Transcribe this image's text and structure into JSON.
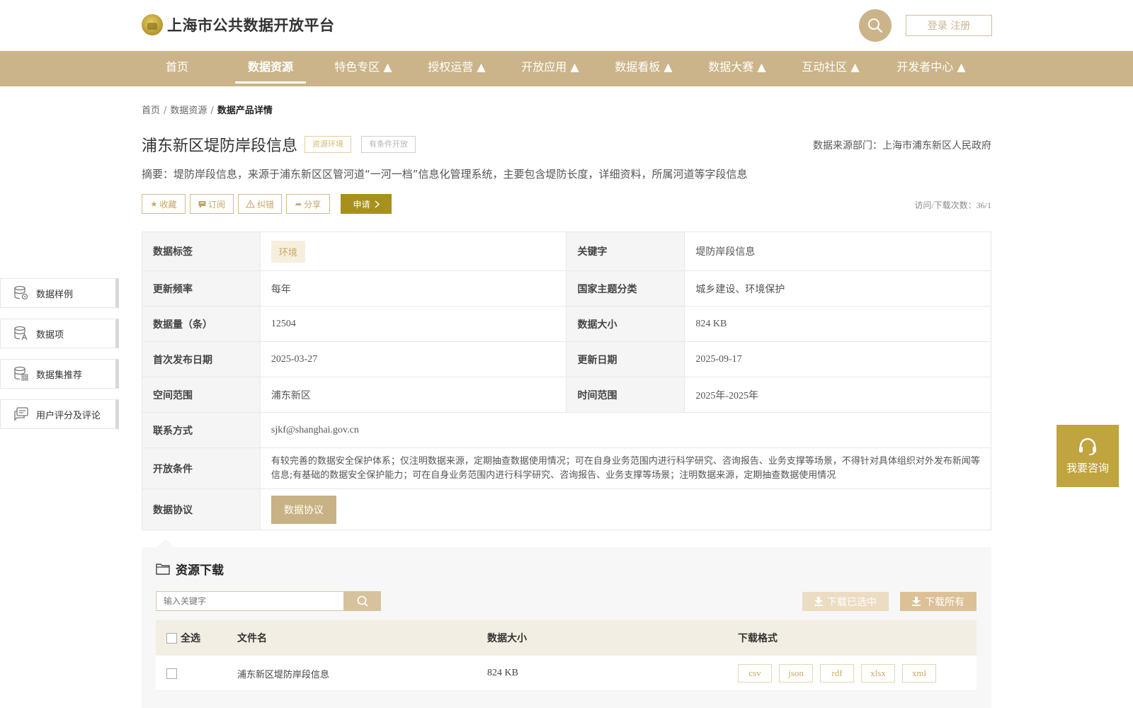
{
  "header": {
    "site_title": "上海市公共数据开放平台",
    "login_label": "登录 注册"
  },
  "nav": {
    "items": [
      {
        "label": "首页"
      },
      {
        "label": "数据资源"
      },
      {
        "label": "特色专区 ▲"
      },
      {
        "label": "授权运营 ▲"
      },
      {
        "label": "开放应用 ▲"
      },
      {
        "label": "数据看板 ▲"
      },
      {
        "label": "数据大赛 ▲"
      },
      {
        "label": "互动社区 ▲"
      },
      {
        "label": "开发者中心 ▲"
      }
    ],
    "active_index": 1
  },
  "breadcrumb": {
    "home": "首页",
    "resources": "数据资源",
    "current": "数据产品详情",
    "separator": "/"
  },
  "dataset": {
    "title": "浦东新区堤防岸段信息",
    "tag_topic": "资源环境",
    "tag_open": "有条件开放",
    "source_dept": "数据来源部门：上海市浦东新区人民政府",
    "summary": "摘要：堤防岸段信息，来源于浦东新区区管河道“一河一档”信息化管理系统，主要包含堤防长度，详细资料，所属河道等字段信息",
    "visits": "访问/下载次数：36/1"
  },
  "actions": {
    "favorite": "收藏",
    "subscribe": "订阅",
    "report": "纠错",
    "share": "分享",
    "apply": "申请"
  },
  "info": {
    "tag_label": "数据标签",
    "tag_value": "环境",
    "keyword_label": "关键字",
    "keyword_value": "堤防岸段信息",
    "freq_label": "更新频率",
    "freq_value": "每年",
    "theme_label": "国家主题分类",
    "theme_value": "城乡建设、环境保护",
    "count_label": "数据量（条）",
    "count_value": "12504",
    "size_label": "数据大小",
    "size_value": "824 KB",
    "first_label": "首次发布日期",
    "first_value": "2025-03-27",
    "update_label": "更新日期",
    "update_value": "2025-09-17",
    "space_label": "空间范围",
    "space_value": "浦东新区",
    "time_label": "时间范围",
    "time_value": "2025年-2025年",
    "contact_label": "联系方式",
    "contact_value": "sjkf@shanghai.gov.cn",
    "condition_label": "开放条件",
    "condition_value": "有较完善的数据安全保护体系；仅注明数据来源，定期抽查数据使用情况；可在自身业务范围内进行科学研究、咨询报告、业务支撑等场景，不得针对具体组织对外发布新闻等信息;有基础的数据安全保护能力；可在自身业务范围内进行科学研究、咨询报告、业务支撑等场景；注明数据来源，定期抽查数据使用情况",
    "protocol_label": "数据协议",
    "protocol_button": "数据协议"
  },
  "side_menu": {
    "items": [
      {
        "label": "数据样例",
        "icon": "database-sample-icon"
      },
      {
        "label": "数据项",
        "icon": "database-field-icon"
      },
      {
        "label": "数据集推荐",
        "icon": "database-recommend-icon"
      },
      {
        "label": "用户评分及评论",
        "icon": "comment-icon"
      }
    ]
  },
  "consult": {
    "label": "我要咨询"
  },
  "download": {
    "title": "资源下载",
    "search_placeholder": "输入关键字",
    "download_selected": "下载已选中",
    "download_all": "下载所有",
    "columns": {
      "select_all": "全选",
      "filename": "文件名",
      "size": "数据大小",
      "format": "下载格式"
    },
    "rows": [
      {
        "filename": "浦东新区堤防岸段信息",
        "size": "824 KB",
        "formats": [
          "csv",
          "json",
          "rdf",
          "xlsx",
          "xml"
        ]
      }
    ]
  },
  "colors": {
    "brand_gold": "#cbb48a",
    "apply_olive": "#a8901f",
    "consult_gold": "#bfa440"
  }
}
